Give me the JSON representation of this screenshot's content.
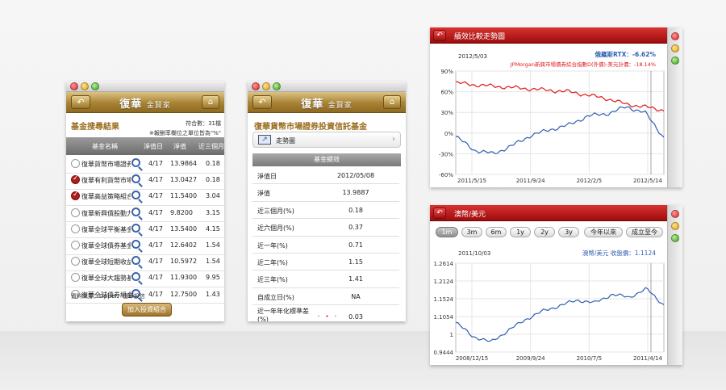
{
  "search_window": {
    "brand": "復華",
    "brand_suffix": "金賢家",
    "heading": "基金搜尋結果",
    "count_label": "符合數：31檔",
    "note": "※報酬率欄位之單位皆為\"%\"",
    "columns": [
      "基金名稱",
      "淨值日",
      "淨值",
      "近三個月"
    ],
    "rows": [
      {
        "name": "復華貨幣市場證券投資信託基金",
        "date": "4/17",
        "nav": "13.9864",
        "ret": "0.18",
        "checked": false
      },
      {
        "name": "復華有利貨幣市場基金",
        "date": "4/17",
        "nav": "13.0427",
        "ret": "0.18",
        "checked": true
      },
      {
        "name": "復華高益策略組合基金",
        "date": "4/17",
        "nav": "11.5400",
        "ret": "3.04",
        "checked": true
      },
      {
        "name": "復華新興債股動力基金",
        "date": "4/17",
        "nav": "9.8200",
        "ret": "3.15",
        "checked": false
      },
      {
        "name": "復華全球平衡基金",
        "date": "4/17",
        "nav": "13.5400",
        "ret": "4.15",
        "checked": false
      },
      {
        "name": "復華全球債券基金",
        "date": "4/17",
        "nav": "12.6402",
        "ret": "1.54",
        "checked": false
      },
      {
        "name": "復華全球短期收益基金",
        "date": "4/17",
        "nav": "10.5972",
        "ret": "1.54",
        "checked": false
      },
      {
        "name": "復華全球大趨勢基金",
        "date": "4/17",
        "nav": "11.9300",
        "ret": "9.95",
        "checked": false
      },
      {
        "name": "復華全球債券組合基金",
        "date": "4/17",
        "nav": "12.7500",
        "ret": "1.43",
        "checked": false
      }
    ],
    "source": "資料來源：Lipper、復華投信",
    "add_button": "加入投資組合"
  },
  "detail_window": {
    "brand": "復華",
    "brand_suffix": "金賢家",
    "fund_name": "復華貨幣市場證券投資信託基金",
    "trend_label": "走勢圖",
    "section_title": "基金績效",
    "rows": [
      {
        "label": "淨值日",
        "value": "2012/05/08"
      },
      {
        "label": "淨值",
        "value": "13.9887"
      },
      {
        "label": "近三個月(%)",
        "value": "0.18"
      },
      {
        "label": "近六個月(%)",
        "value": "0.37"
      },
      {
        "label": "近一年(%)",
        "value": "0.71"
      },
      {
        "label": "近二年(%)",
        "value": "1.15"
      },
      {
        "label": "近三年(%)",
        "value": "1.41"
      },
      {
        "label": "自成立日(%)",
        "value": "NA"
      },
      {
        "label": "近一年年化標準差(%)",
        "value": "0.03"
      }
    ]
  },
  "compare_window": {
    "title": "績效比較走勢圖",
    "date_label": "2012/5/03",
    "legend_blue": "俄羅斯RTX：-6.62%",
    "legend_red": "JPMorgan新興市場債券綜合指數D(外債)-美元計價：-18.14%",
    "y_ticks": [
      "90%",
      "60%",
      "30%",
      "0%",
      "-30%",
      "-60%"
    ],
    "x_ticks": [
      "2011/5/15",
      "2011/9/24",
      "2012/2/5",
      "2012/5/14"
    ],
    "colors": {
      "blue": "#2f5fb0",
      "red": "#e01818"
    }
  },
  "fx_window": {
    "title": "澳幣/美元",
    "ranges": [
      "1m",
      "3m",
      "6m",
      "1y",
      "2y",
      "3y",
      "今年以來",
      "成立至今"
    ],
    "selected_range": "1m",
    "date_label": "2011/10/03",
    "legend": "澳幣/美元 收盤價：1.1124",
    "y_ticks": [
      "1.2614",
      "1.2124",
      "1.1524",
      "1.1054",
      "1",
      "0.9444"
    ],
    "x_ticks": [
      "2008/12/15",
      "2009/9/24",
      "2010/7/5",
      "2011/4/14"
    ]
  },
  "chart_data": [
    {
      "type": "line",
      "title": "績效比較走勢圖",
      "x": [
        "2011/5/15",
        "2011/9/24",
        "2012/2/5",
        "2012/5/14"
      ],
      "ylim": [
        -60,
        90
      ],
      "series": [
        {
          "name": "俄羅斯RTX",
          "values": [
            -5,
            -25,
            -30,
            -18,
            -3,
            5,
            12,
            25,
            28,
            38,
            30,
            -6.62
          ]
        },
        {
          "name": "JPMorgan新興市場債券綜合指數D(外債)-美元計價",
          "values": [
            73,
            70,
            68,
            66,
            64,
            62,
            60,
            55,
            50,
            42,
            38,
            33
          ]
        }
      ]
    },
    {
      "type": "line",
      "title": "澳幣/美元",
      "x": [
        "2008/12/15",
        "2009/9/24",
        "2010/7/5",
        "2011/4/14"
      ],
      "ylim": [
        0.9444,
        1.2614
      ],
      "series": [
        {
          "name": "澳幣/美元",
          "values": [
            1.05,
            1.0,
            0.98,
            1.02,
            1.06,
            1.09,
            1.11,
            1.13,
            1.12,
            1.15,
            1.14,
            1.17,
            1.1124
          ]
        }
      ]
    }
  ]
}
